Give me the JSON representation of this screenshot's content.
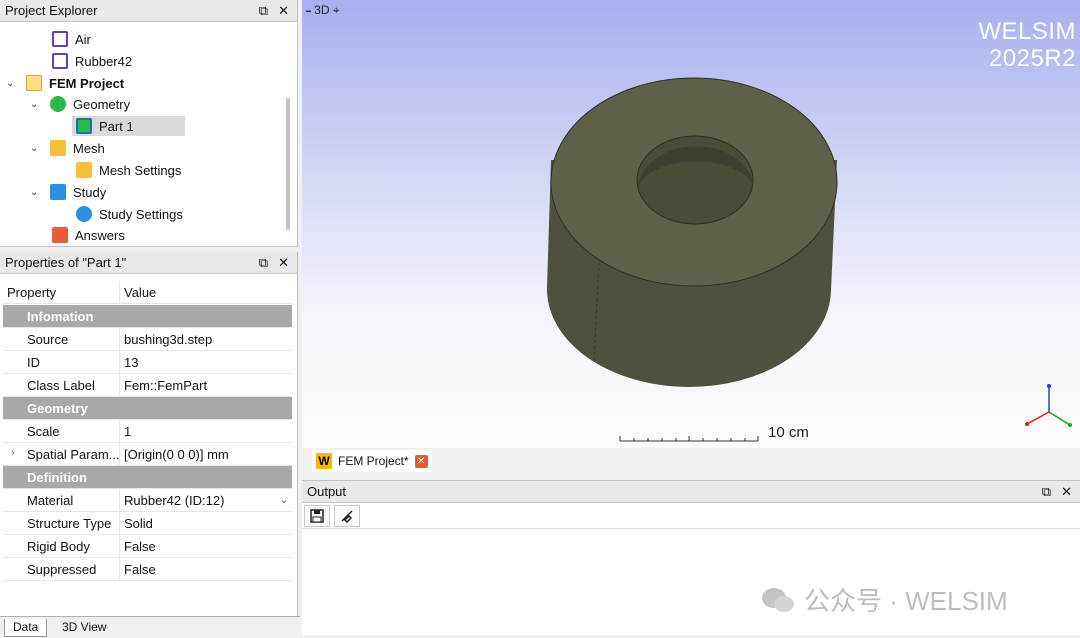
{
  "explorer": {
    "title": "Project Explorer",
    "items": [
      {
        "label": "Air"
      },
      {
        "label": "Rubber42"
      },
      {
        "label": "FEM Project"
      },
      {
        "label": "Geometry"
      },
      {
        "label": "Part 1"
      },
      {
        "label": "Mesh"
      },
      {
        "label": "Mesh Settings"
      },
      {
        "label": "Study"
      },
      {
        "label": "Study Settings"
      },
      {
        "label": "Answers"
      }
    ]
  },
  "properties": {
    "title": "Properties of \"Part 1\"",
    "col_property": "Property",
    "col_value": "Value",
    "rows": [
      {
        "group": "Infomation"
      },
      {
        "key": "Source",
        "value": "bushing3d.step"
      },
      {
        "key": "ID",
        "value": "13"
      },
      {
        "key": "Class Label",
        "value": "Fem::FemPart"
      },
      {
        "group": "Geometry"
      },
      {
        "key": "Scale",
        "value": "1"
      },
      {
        "key": "Spatial Param...",
        "value": "[Origin(0 0 0)] mm"
      },
      {
        "group": "Definition"
      },
      {
        "key": "Material",
        "value": "Rubber42 (ID:12)"
      },
      {
        "key": "Structure Type",
        "value": "Solid"
      },
      {
        "key": "Rigid Body",
        "value": "False"
      },
      {
        "key": "Suppressed",
        "value": "False"
      }
    ]
  },
  "bottom_tabs": [
    "Data",
    "3D View"
  ],
  "view3d": {
    "tag": "3D",
    "brand_line1": "WELSIM",
    "brand_line2": "2025R2",
    "scale_label": "10 cm",
    "colors": {
      "part": "#5c5d47",
      "part_dark": "#4a4b38"
    }
  },
  "doc_tab": {
    "label": "FEM Project*",
    "logo": "W"
  },
  "output": {
    "title": "Output"
  },
  "watermark": {
    "text": "公众号 · WELSIM"
  }
}
